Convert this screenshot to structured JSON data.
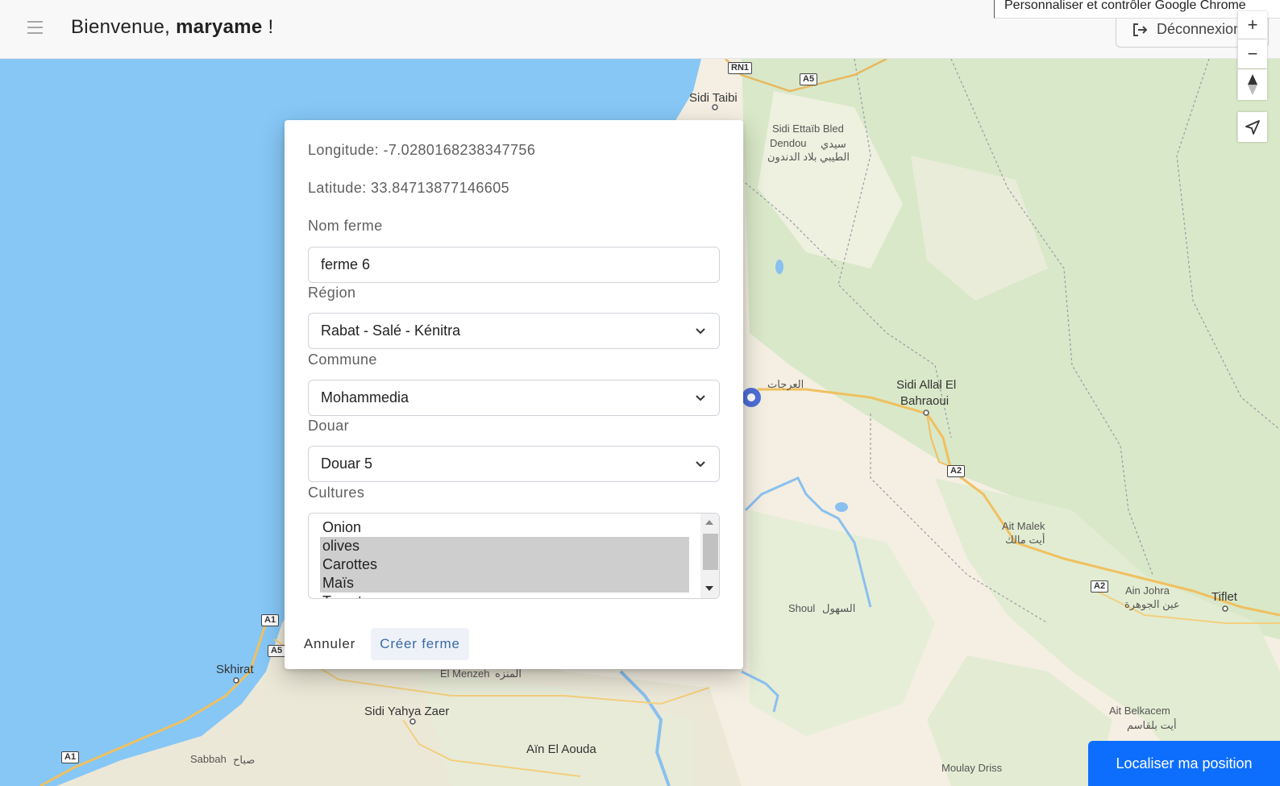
{
  "header": {
    "greeting_prefix": "Bienvenue,",
    "username": "maryame",
    "greeting_suffix": "!",
    "logout_label": "Déconnexion",
    "chrome_tooltip": "Personnaliser et contrôler Google Chrome"
  },
  "map": {
    "labels": {
      "sidi_taibi": "Sidi Taibi",
      "sidi_ettaib_1": "Sidi Ettaïb Bled",
      "sidi_ettaib_2": "Dendou",
      "sidi_ettaib_ar1": "سيدي",
      "sidi_ettaib_ar2": "الطيبي بلاد الدندون",
      "sidi_allal_1": "Sidi Allal El",
      "sidi_allal_2": "Bahraoui",
      "laarjate": "العرجات",
      "ait_malek": "Ait Malek",
      "ait_malek_ar": "أيت مالك",
      "ain_johra": "Ain Johra",
      "ain_johra_ar": "عين الجوهرة",
      "tiflet": "Tiflet",
      "shoul": "Shoul",
      "shoul_ar": "السهول",
      "skhirat": "Skhirat",
      "el_menzeh": "El Menzeh",
      "el_menzeh_ar": "المنزه",
      "sidi_yahya": "Sidi Yahya Zaer",
      "ain_el_aouda": "Aïn El Aouda",
      "sabbah": "Sabbah",
      "sabbah_ar": "صباح",
      "moulay_driss": "Moulay Driss",
      "ait_belkacem": "Ait Belkacem",
      "ait_belkacem_ar": "أيت بلقاسم"
    },
    "roads": {
      "rn1": "RN1",
      "a5_top": "A5",
      "a2_a": "A2",
      "a2_b": "A2",
      "a1_a": "A1",
      "a5_b": "A5",
      "a1_b": "A1"
    },
    "controls": {
      "zoom_in": "+",
      "zoom_out": "−"
    },
    "locate_label": "Localiser ma position"
  },
  "modal": {
    "longitude": "Longitude: -7.0280168238347756",
    "latitude": "Latitude: 33.84713877146605",
    "nom_label": "Nom ferme",
    "nom_value": "ferme 6",
    "region_label": "Région",
    "region_value": "Rabat - Salé - Kénitra",
    "commune_label": "Commune",
    "commune_value": "Mohammedia",
    "douar_label": "Douar",
    "douar_value": "Douar 5",
    "cultures_label": "Cultures",
    "cultures": [
      {
        "label": "Onion",
        "selected": false
      },
      {
        "label": "olives",
        "selected": true
      },
      {
        "label": "Carottes",
        "selected": true
      },
      {
        "label": "Maïs",
        "selected": true
      },
      {
        "label": "Tomates",
        "selected": false
      }
    ],
    "cancel_label": "Annuler",
    "create_label": "Créer ferme"
  },
  "colors": {
    "sea": "#86c7f6",
    "land": "#f4efe2",
    "green": "#d7e7c5",
    "primary": "#0d6efd"
  }
}
